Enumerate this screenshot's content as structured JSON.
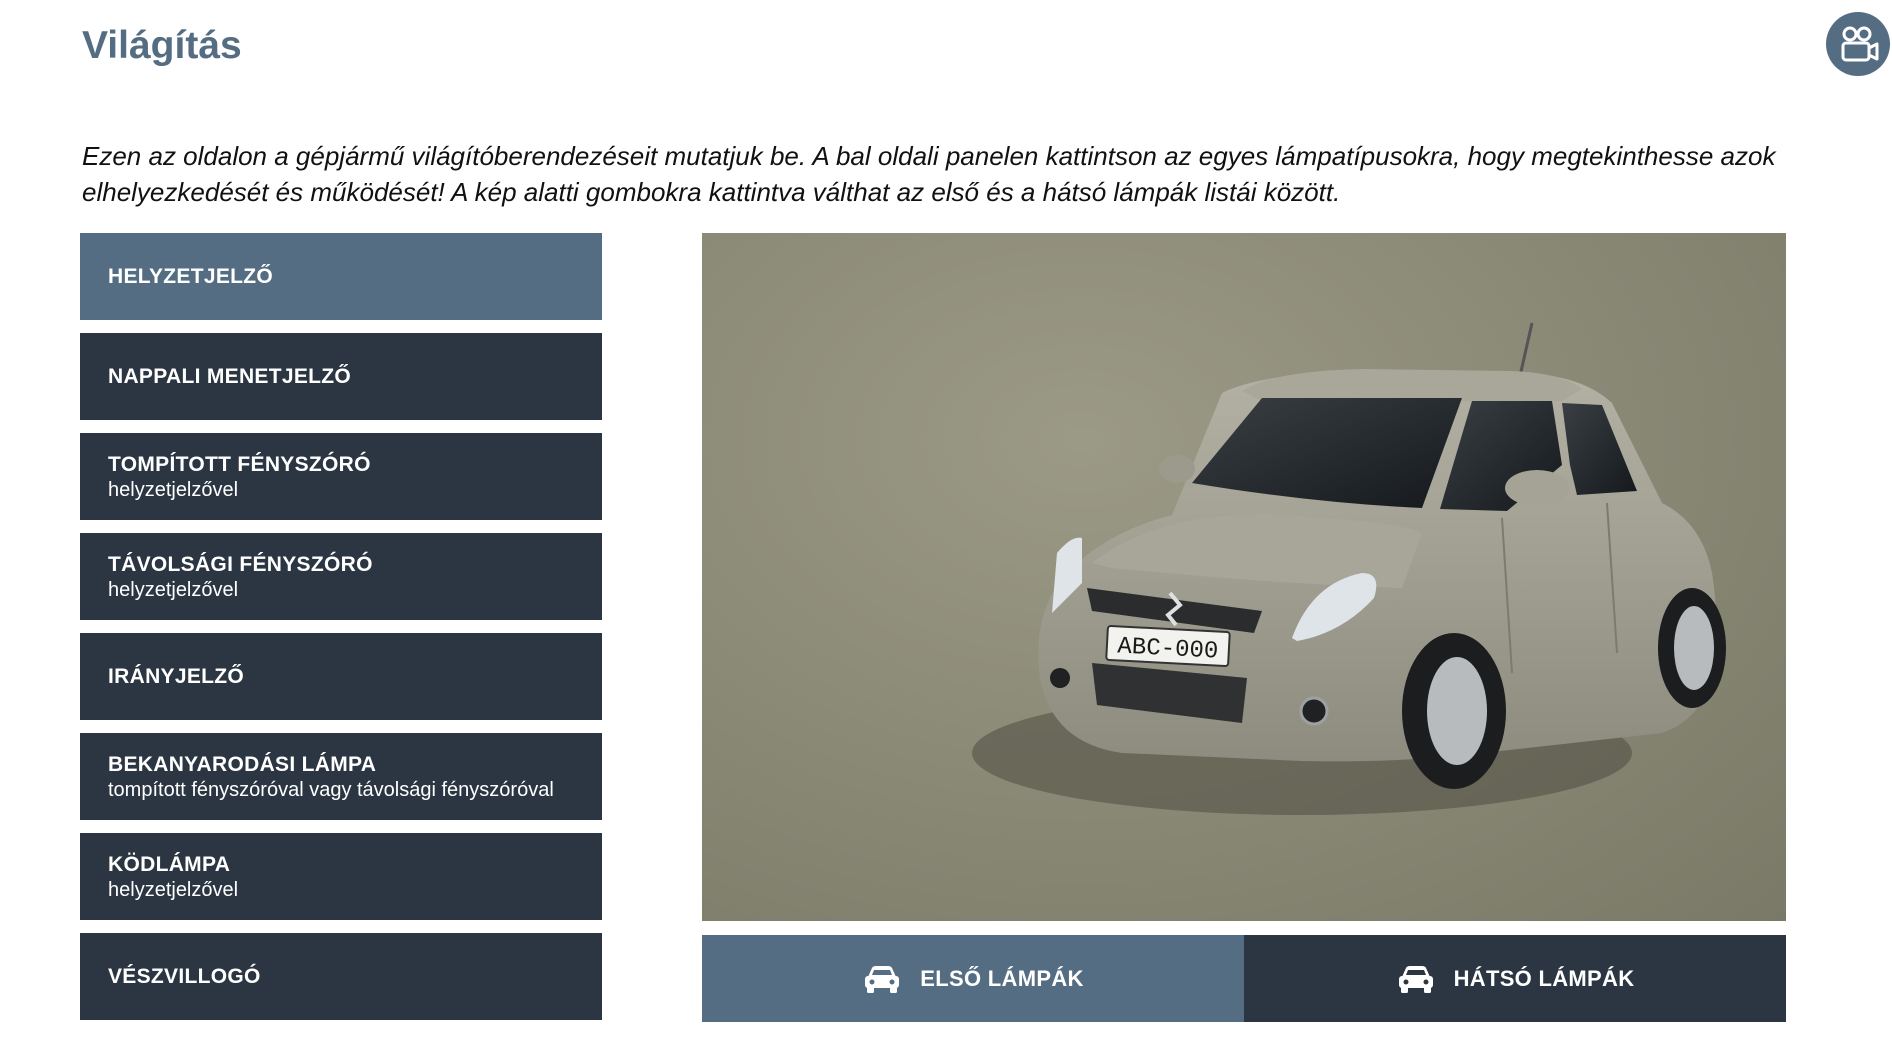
{
  "header": {
    "title": "Világítás",
    "camera_icon": "video-camera-icon"
  },
  "intro": {
    "text": "Ezen az oldalon a gépjármű világítóberendezéseit mutatjuk be. A bal oldali panelen kattintson az egyes lámpatípusokra, hogy megtekinthesse azok elhelyezkedését és működését! A kép alatti gombokra kattintva válthat az első és a hátsó lámpák listái között."
  },
  "lamps": {
    "active_index": 0,
    "items": [
      {
        "title": "HELYZETJELZŐ",
        "subtitle": ""
      },
      {
        "title": "NAPPALI MENETJELZŐ",
        "subtitle": ""
      },
      {
        "title": "TOMPÍTOTT FÉNYSZÓRÓ",
        "subtitle": "helyzetjelzővel"
      },
      {
        "title": "TÁVOLSÁGI FÉNYSZÓRÓ",
        "subtitle": "helyzetjelzővel"
      },
      {
        "title": "IRÁNYJELZŐ",
        "subtitle": ""
      },
      {
        "title": "BEKANYARODÁSI LÁMPA",
        "subtitle": "tompított fényszóróval vagy távolsági fényszóróval"
      },
      {
        "title": "KÖDLÁMPA",
        "subtitle": "helyzetjelzővel"
      },
      {
        "title": "VÉSZVILLOGÓ",
        "subtitle": ""
      }
    ]
  },
  "car_view": {
    "plate": "ABC-000",
    "colors": {
      "background": "#8c8b78",
      "body": "#a7a596"
    }
  },
  "tabs": {
    "active": "front",
    "front_label": "ELSŐ LÁMPÁK",
    "rear_label": "HÁTSÓ LÁMPÁK",
    "icon": "car-icon"
  },
  "colors": {
    "accent": "#546d82",
    "dark": "#2b3642"
  }
}
